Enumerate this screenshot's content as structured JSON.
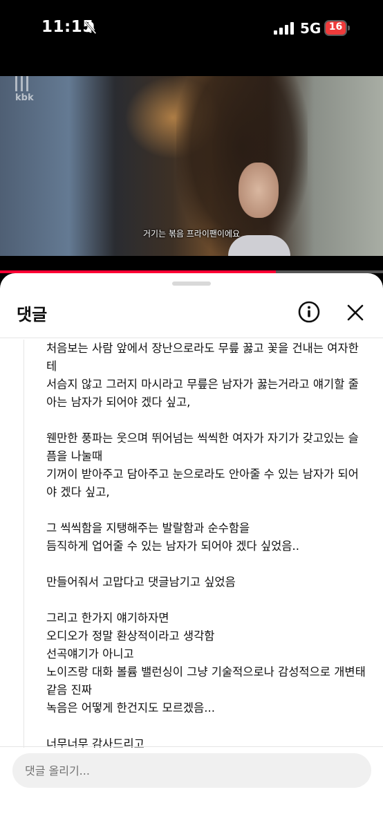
{
  "status_bar": {
    "time": "11:15",
    "network": "5G",
    "battery_level": "16"
  },
  "video": {
    "channel_logo": "kbk",
    "subtitle": "거기는 볶음 프라이팬이에요",
    "progress_fraction": 0.72
  },
  "comments_panel": {
    "title": "댓글",
    "comment_lines": [
      "처음보는 사람 앞에서 장난으로라도 무릎 꿇고 꽃을 건내는 여자한",
      "테",
      "서슴지 않고 그러지 마시라고 무릎은 남자가 꿇는거라고 얘기할 줄",
      "아는 남자가 되어야 겠다 싶고,",
      "",
      "웬만한 풍파는 웃으며 뛰어넘는 씩씩한 여자가 자기가 갖고있는 슬",
      "픔을 나눌때",
      "기꺼이 받아주고 담아주고 눈으로라도 안아줄 수 있는 남자가 되어",
      "야 겠다 싶고,",
      "",
      "그 씩씩함을 지탱해주는 발랄함과 순수함을",
      "듬직하게 업어줄 수 있는 남자가 되어야 겠다 싶었음..",
      "",
      "만들어줘서 고맙다고 댓글남기고 싶었음",
      "",
      "그리고 한가지 얘기하자면",
      "오디오가 정말 환상적이라고 생각함",
      "선곡얘기가 아니고",
      "노이즈랑 대화 볼륨 밸런싱이 그냥 기술적으로나 감성적으로 개변태",
      "같음 진짜",
      "녹음은 어떻게 한건지도 모르겠음...",
      "",
      "너무너무 감사드리고"
    ],
    "input_placeholder": "댓글 올리기...",
    "icons": {
      "info": "info-icon",
      "close": "close-icon"
    },
    "colors": {
      "progress": "#ff0033",
      "battery": "#ef3b3b"
    }
  }
}
